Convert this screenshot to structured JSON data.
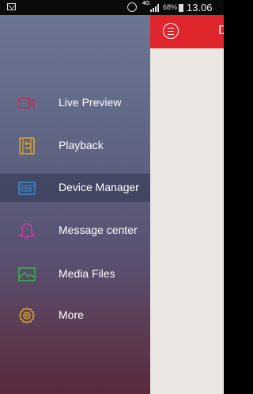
{
  "status_bar": {
    "network": "4G",
    "battery": "68%",
    "time": "13.06"
  },
  "header": {
    "title": "D",
    "accent_color": "#e0262d"
  },
  "menu": {
    "items": [
      {
        "label": "Live Preview",
        "icon": "camera-icon",
        "color": "#c2305a"
      },
      {
        "label": "Playback",
        "icon": "playback-icon",
        "color": "#e0a526"
      },
      {
        "label": "Device Manager",
        "icon": "device-manager-icon",
        "color": "#2f8fd8",
        "active": true
      },
      {
        "label": "Message center",
        "icon": "bell-icon",
        "color": "#c43ba0"
      },
      {
        "label": "Media Files",
        "icon": "image-icon",
        "color": "#35b24a"
      },
      {
        "label": "More",
        "icon": "gear-icon",
        "color": "#e0a526"
      }
    ]
  }
}
